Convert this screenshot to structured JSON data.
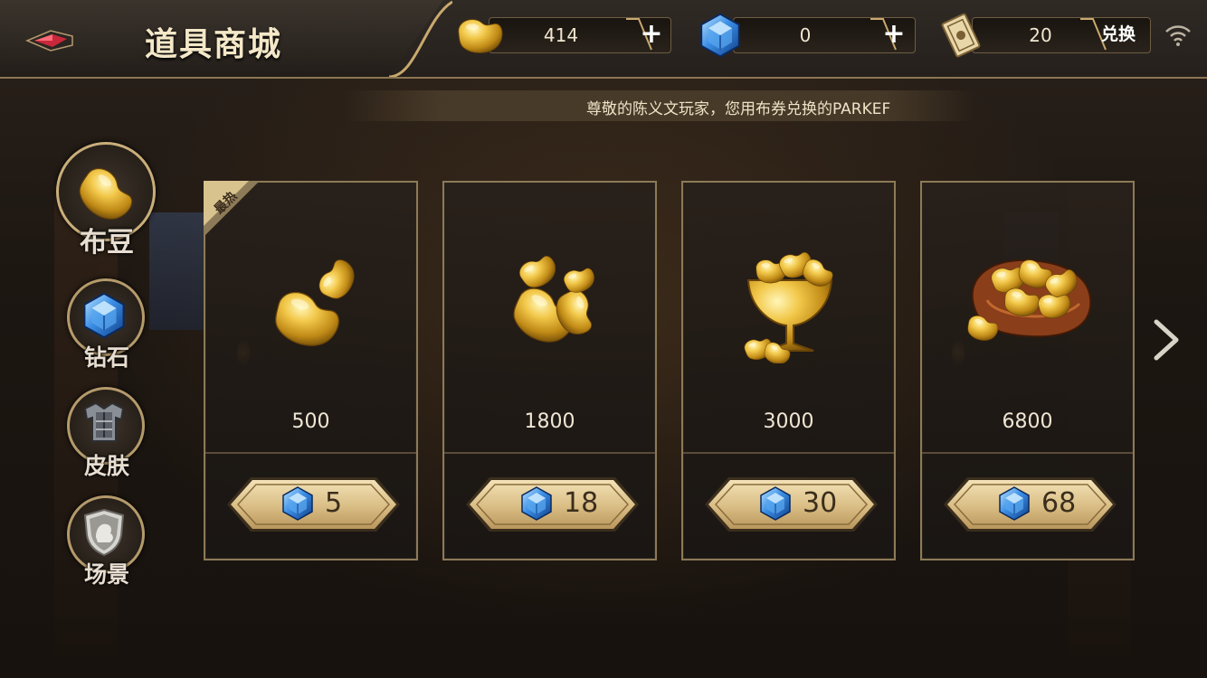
{
  "header": {
    "title": "道具商城",
    "back_icon": "back-arrow-icon"
  },
  "currencies": {
    "beans": {
      "icon": "bean-icon",
      "value": "414",
      "action": "+"
    },
    "diamonds": {
      "icon": "diamond-icon",
      "value": "0",
      "action": "+"
    },
    "coupons": {
      "icon": "coupon-card-icon",
      "value": "20",
      "action": "兑换"
    }
  },
  "status": {
    "wifi_icon": "wifi-icon"
  },
  "marquee": {
    "text": "尊敬的陈义文玩家，您用布券兑换的PARKEF"
  },
  "sidebar": {
    "items": [
      {
        "label": "布豆",
        "icon": "bean-icon",
        "active": true
      },
      {
        "label": "钻石",
        "icon": "diamond-icon",
        "active": false
      },
      {
        "label": "皮肤",
        "icon": "armor-icon",
        "active": false
      },
      {
        "label": "场景",
        "icon": "shield-lion-icon",
        "active": false
      }
    ]
  },
  "products": [
    {
      "amount": "500",
      "price": "5",
      "badge": "最热",
      "icon": "two-beans-icon"
    },
    {
      "amount": "1800",
      "price": "18",
      "badge": "",
      "icon": "bean-pile-icon"
    },
    {
      "amount": "3000",
      "price": "30",
      "badge": "",
      "icon": "bean-goblet-icon"
    },
    {
      "amount": "6800",
      "price": "68",
      "badge": "",
      "icon": "bean-sack-icon"
    }
  ],
  "nav": {
    "next_icon": "chevron-right-icon"
  },
  "colors": {
    "accent_gold": "#c9a96e",
    "frame": "#8c7a58",
    "gem_blue": "#2f7fd8"
  }
}
